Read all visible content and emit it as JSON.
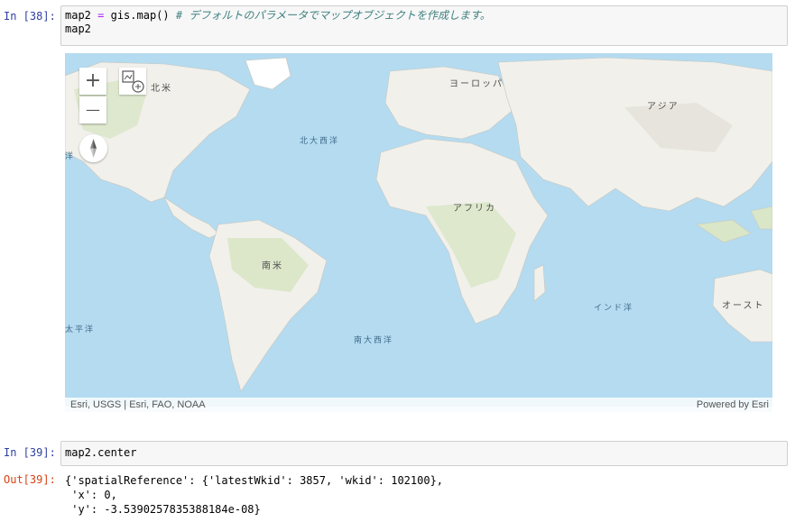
{
  "cells": [
    {
      "prompt": "In [38]:",
      "code": {
        "line1_var": "map2",
        "line1_op": "=",
        "line1_call": "gis.map()",
        "line1_comment": "# デフォルトのパラメータでマップオブジェクトを作成します。",
        "line2": "map2"
      }
    },
    {
      "prompt": "In [39]:",
      "code": {
        "line1": "map2.center"
      },
      "out_prompt": "Out[39]:",
      "output_lines": [
        "{'spatialReference': {'latestWkid': 3857, 'wkid': 102100},",
        " 'x': 0,",
        " 'y': -3.5390257835388184e-08}"
      ]
    }
  ],
  "map": {
    "labels": {
      "north_america": "北米",
      "europe": "ヨーロッパ",
      "asia": "アジア",
      "north_atlantic": "北大西洋",
      "africa": "アフリカ",
      "south_america": "南米",
      "indian_ocean": "インド洋",
      "south_atlantic": "南大西洋",
      "pacific_left_top": "洋",
      "pacific_left_bottom": "太平洋",
      "australia": "オースト"
    },
    "controls": {
      "zoom_in": "+",
      "zoom_out": "—"
    },
    "attribution": {
      "left": "Esri, USGS | Esri, FAO, NOAA",
      "right": "Powered by Esri"
    },
    "colors": {
      "ocean": "#b4dbf0",
      "land": "#f1f0eb",
      "vegetation": "#d9e6c7"
    },
    "icons": [
      "zoom-in-icon",
      "zoom-out-icon",
      "compass-icon",
      "basemap-widget-icon"
    ]
  }
}
